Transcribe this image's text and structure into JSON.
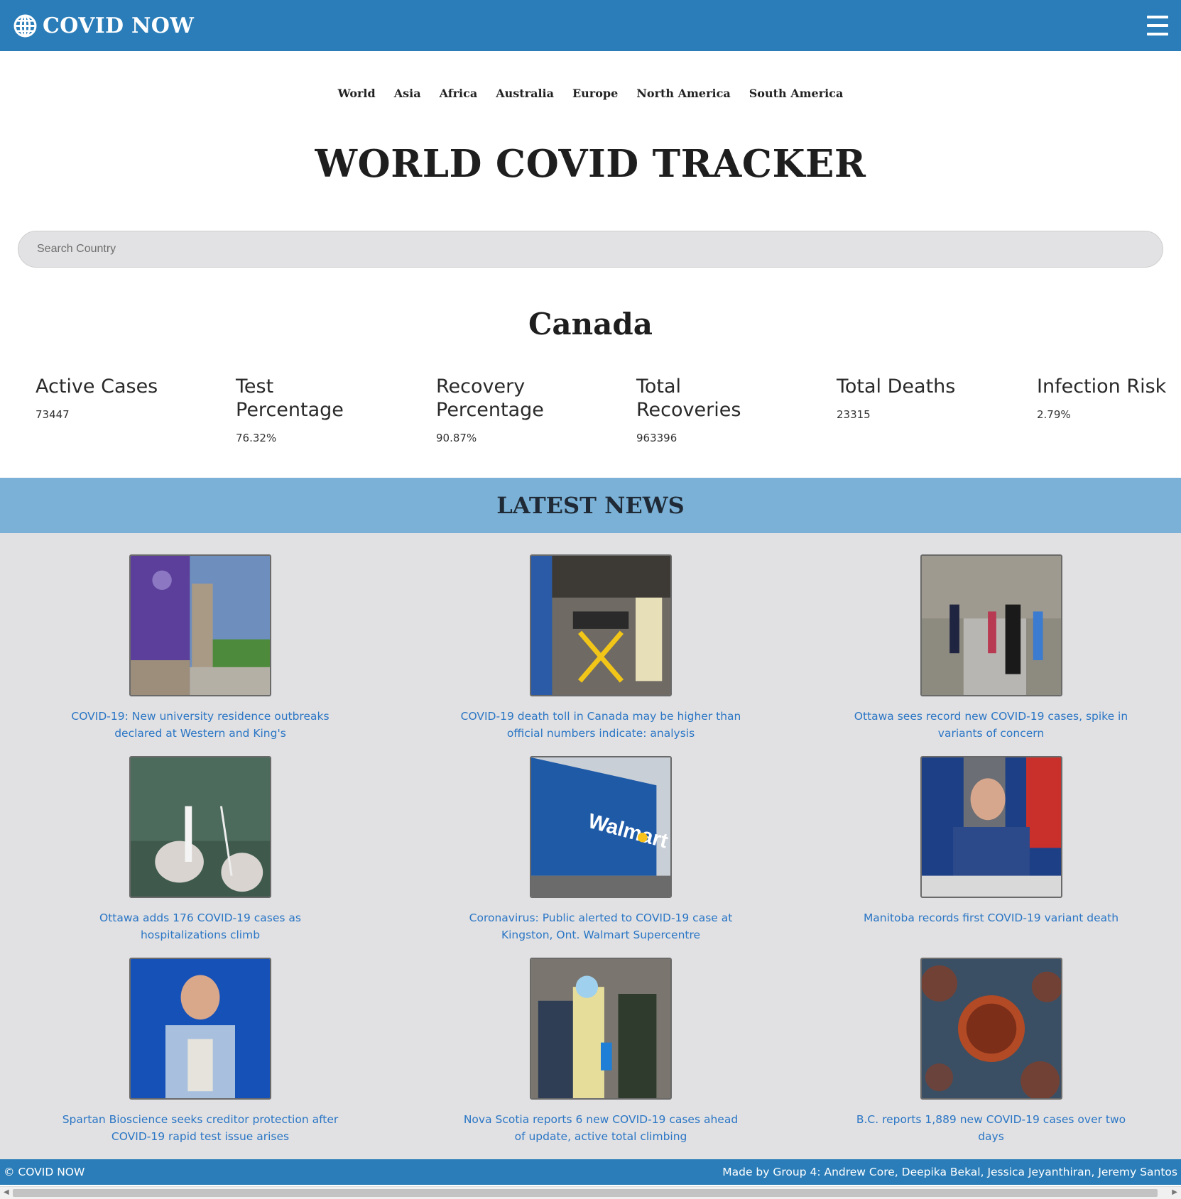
{
  "header": {
    "brand": "COVID NOW",
    "logo_icon": "globe-icon",
    "menu_icon": "hamburger-icon"
  },
  "regions": [
    "World",
    "Asia",
    "Africa",
    "Australia",
    "Europe",
    "North America",
    "South America"
  ],
  "title": "WORLD COVID TRACKER",
  "search": {
    "placeholder": "Search Country",
    "value": ""
  },
  "country": "Canada",
  "stats": [
    {
      "label": "Active Cases",
      "value": "73447"
    },
    {
      "label": "Test Percentage",
      "value": "76.32%"
    },
    {
      "label": "Recovery Percentage",
      "value": "90.87%"
    },
    {
      "label": "Total Recoveries",
      "value": "963396"
    },
    {
      "label": "Total Deaths",
      "value": "23315"
    },
    {
      "label": "Infection Risk",
      "value": "2.79%"
    }
  ],
  "news": {
    "heading": "LATEST NEWS",
    "items": [
      {
        "headline": "COVID-19: New university residence outbreaks declared at Western and King's",
        "image": "university-sign-photo"
      },
      {
        "headline": "COVID-19 death toll in Canada may be higher than official numbers indicate: analysis",
        "image": "hospital-stretcher-photo"
      },
      {
        "headline": "Ottawa sees record new COVID-19 cases, spike in variants of concern",
        "image": "people-walking-path-photo"
      },
      {
        "headline": "Ottawa adds 176 COVID-19 cases as hospitalizations climb",
        "image": "test-swab-photo"
      },
      {
        "headline": "Coronavirus: Public alerted to COVID-19 case at Kingston, Ont. Walmart Supercentre",
        "image": "walmart-store-photo"
      },
      {
        "headline": "Manitoba records first COVID-19 variant death",
        "image": "press-conference-photo"
      },
      {
        "headline": "Spartan Bioscience seeks creditor protection after COVID-19 rapid test issue arises",
        "image": "man-with-test-device-photo"
      },
      {
        "headline": "Nova Scotia reports 6 new COVID-19 cases ahead of update, active total climbing",
        "image": "testing-site-photo"
      },
      {
        "headline": "B.C. reports 1,889 new COVID-19 cases over two days",
        "image": "virus-illustration-photo"
      }
    ]
  },
  "footer": {
    "left": "© COVID NOW",
    "right": "Made by Group 4: Andrew Core, Deepika Bekal, Jessica Jeyanthiran, Jeremy Santos"
  },
  "colors": {
    "primary": "#2a7db8",
    "news_band": "#7bb1d6",
    "news_bg": "#e1e1e3",
    "link": "#2b76c5"
  }
}
